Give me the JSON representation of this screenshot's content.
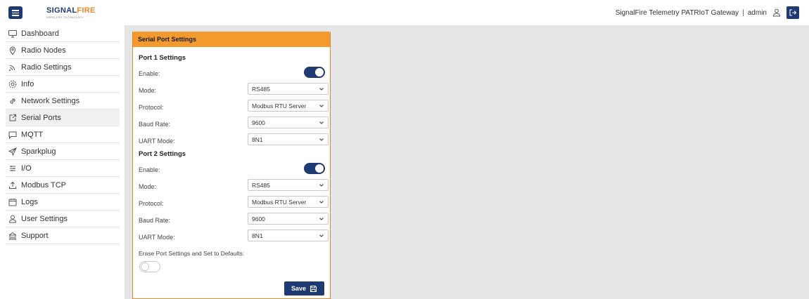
{
  "header": {
    "logo_part1": "SIGNAL",
    "logo_part2": "FIRE",
    "logo_sub": "WIRELESS TECHNOLOGY",
    "gateway_title": "SignalFire Telemetry PATRIoT Gateway",
    "separator": "|",
    "user": "admin"
  },
  "sidebar": {
    "items": [
      {
        "label": "Dashboard",
        "icon": "dashboard-icon"
      },
      {
        "label": "Radio Nodes",
        "icon": "map-pin-icon"
      },
      {
        "label": "Radio Settings",
        "icon": "signal-icon"
      },
      {
        "label": "Info",
        "icon": "gear-icon"
      },
      {
        "label": "Network Settings",
        "icon": "link-icon"
      },
      {
        "label": "Serial Ports",
        "icon": "external-link-icon",
        "active": true
      },
      {
        "label": "MQTT",
        "icon": "chat-icon"
      },
      {
        "label": "Sparkplug",
        "icon": "send-icon"
      },
      {
        "label": "I/O",
        "icon": "list-icon"
      },
      {
        "label": "Modbus TCP",
        "icon": "upload-icon"
      },
      {
        "label": "Logs",
        "icon": "calendar-icon"
      },
      {
        "label": "User Settings",
        "icon": "user-icon"
      },
      {
        "label": "Support",
        "icon": "building-icon"
      }
    ]
  },
  "card": {
    "title": "Serial Port Settings",
    "port1": {
      "title": "Port 1 Settings",
      "enable_label": "Enable:",
      "enabled": true,
      "mode_label": "Mode:",
      "mode": "RS485",
      "protocol_label": "Protocol:",
      "protocol": "Modbus RTU Server",
      "baud_label": "Baud Rate:",
      "baud": "9600",
      "uart_label": "UART Mode:",
      "uart": "8N1"
    },
    "port2": {
      "title": "Port 2 Settings",
      "enable_label": "Enable:",
      "enabled": true,
      "mode_label": "Mode:",
      "mode": "RS485",
      "protocol_label": "Protocol:",
      "protocol": "Modbus RTU Server",
      "baud_label": "Baud Rate:",
      "baud": "9600",
      "uart_label": "UART Mode:",
      "uart": "8N1"
    },
    "erase_label": "Erase Port Settings and Set to Defaults:",
    "erase_enabled": false,
    "save_label": "Save"
  },
  "colors": {
    "brand_navy": "#1f3a73",
    "brand_orange": "#e8872a",
    "card_header": "#f29a2e",
    "background": "#e5e5e5"
  }
}
